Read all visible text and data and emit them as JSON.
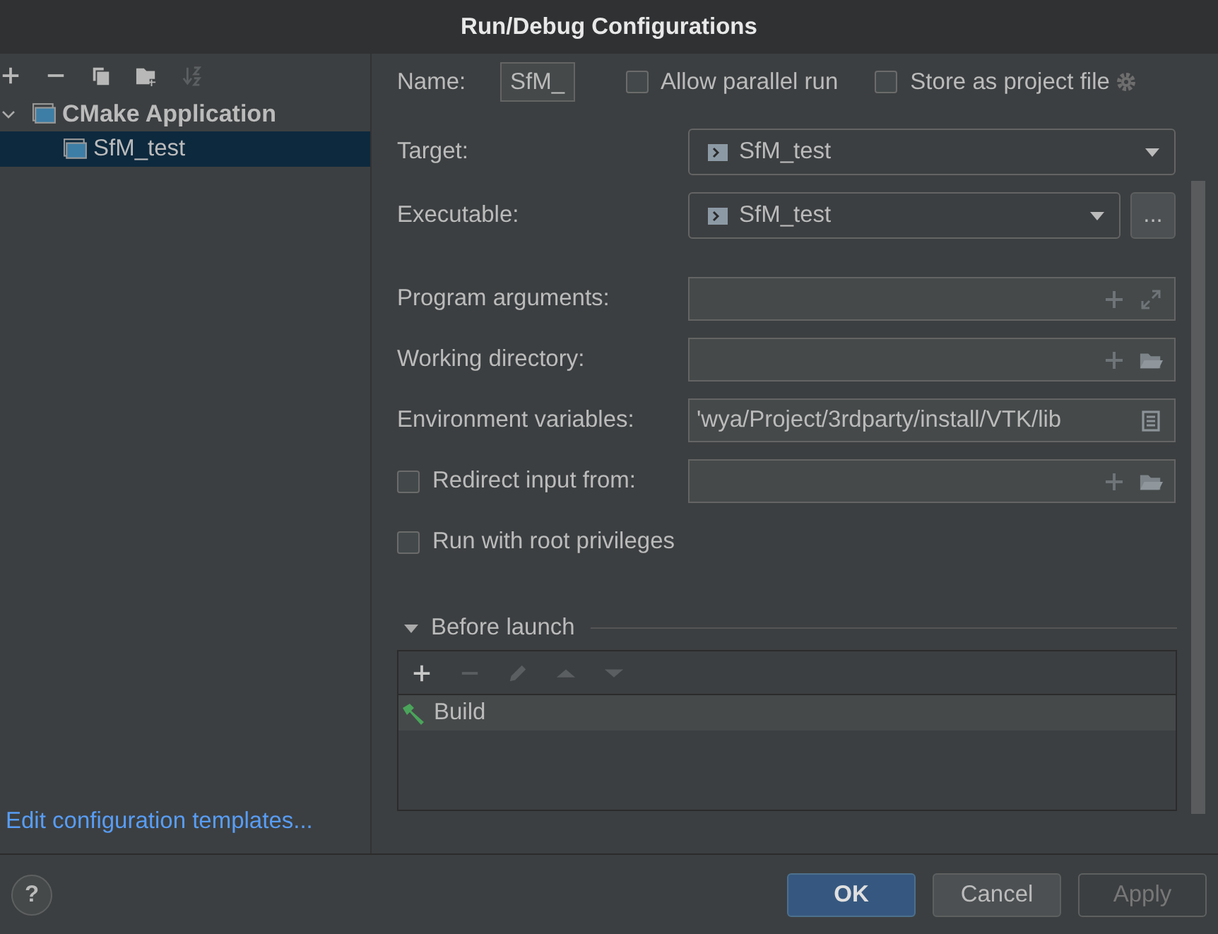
{
  "window": {
    "title": "Run/Debug Configurations"
  },
  "tree_toolbar": [
    {
      "kind": "add",
      "disabled": false
    },
    {
      "kind": "remove",
      "disabled": false
    },
    {
      "kind": "copy",
      "disabled": false
    },
    {
      "kind": "folder",
      "disabled": false
    },
    {
      "kind": "sort",
      "disabled": true
    }
  ],
  "tree": [
    {
      "label": "CMake Application",
      "expanded": true,
      "selected": false,
      "children": [
        {
          "label": "SfM_test",
          "selected": true
        }
      ]
    }
  ],
  "templates_link": "Edit configuration templates...",
  "name_field": {
    "label": "Name:",
    "value": "SfM_"
  },
  "header_options": [
    {
      "label": "Allow parallel run",
      "checked": false
    },
    {
      "label": "Store as project file",
      "checked": false
    }
  ],
  "rows": [
    {
      "kind": "dropdown",
      "label": "Target:",
      "value": "SfM_test"
    },
    {
      "kind": "dropdown-browse",
      "label": "Executable:",
      "value": "SfM_test",
      "button": "..."
    },
    {
      "kind": "spacer"
    },
    {
      "kind": "text-expand",
      "label": "Program arguments:"
    },
    {
      "kind": "text-folder",
      "label": "Working directory:"
    },
    {
      "kind": "text-list",
      "label": "Environment variables:",
      "value": "'wya/Project/3rdparty/install/VTK/lib"
    },
    {
      "kind": "check-folder",
      "label": "Redirect input from:",
      "checked": false
    },
    {
      "kind": "check",
      "label": "Run with root privileges",
      "checked": false
    }
  ],
  "before_launch": {
    "title": "Before launch",
    "expanded": true,
    "tools": [
      {
        "kind": "add",
        "disabled": false
      },
      {
        "kind": "remove",
        "disabled": true
      },
      {
        "kind": "edit",
        "disabled": true
      },
      {
        "kind": "up",
        "disabled": true
      },
      {
        "kind": "down",
        "disabled": true
      }
    ],
    "tasks": [
      {
        "label": "Build",
        "selected": true
      }
    ]
  },
  "help": "?",
  "buttons": [
    {
      "label": "OK",
      "kind": "primary",
      "disabled": false
    },
    {
      "label": "Cancel",
      "kind": "normal",
      "disabled": false
    },
    {
      "label": "Apply",
      "kind": "normal",
      "disabled": true
    }
  ]
}
